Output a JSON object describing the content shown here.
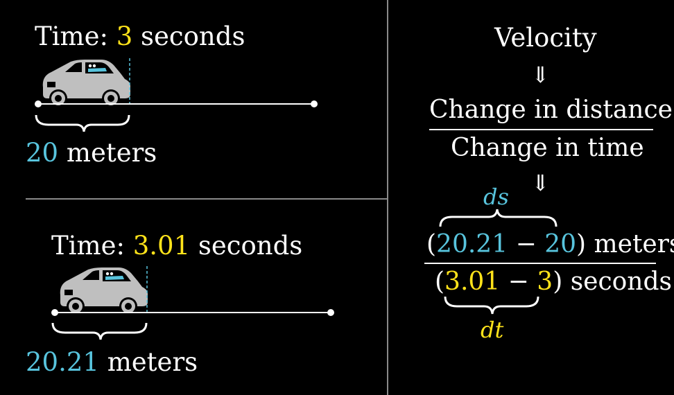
{
  "colors": {
    "background": "#000000",
    "blue": "#58c4dd",
    "yellow": "#ffe31a",
    "white": "#ffffff",
    "divider": "#8a8a8a",
    "car": "#bfbfbf"
  },
  "top_scene": {
    "time_label": "Time:",
    "time_value": "3",
    "time_unit": "seconds",
    "distance_value": "20",
    "distance_unit": "meters",
    "distance_fraction_of_track": 0.33
  },
  "bottom_scene": {
    "time_label": "Time:",
    "time_value": "3.01",
    "time_unit": "seconds",
    "distance_value": "20.21",
    "distance_unit": "meters",
    "distance_fraction_of_track": 0.335
  },
  "derivation": {
    "title": "Velocity",
    "arrow": "⇓",
    "fraction_numerator": "Change in distance",
    "fraction_denominator": "Change in time",
    "ds_label": "ds",
    "dt_label": "dt",
    "num_open": "(",
    "num_a": "20.21",
    "minus": "−",
    "num_b": "20",
    "num_close": ")",
    "num_unit": "meters",
    "den_open": "(",
    "den_a": "3.01",
    "den_b": "3",
    "den_close": ")",
    "den_unit": "seconds"
  }
}
